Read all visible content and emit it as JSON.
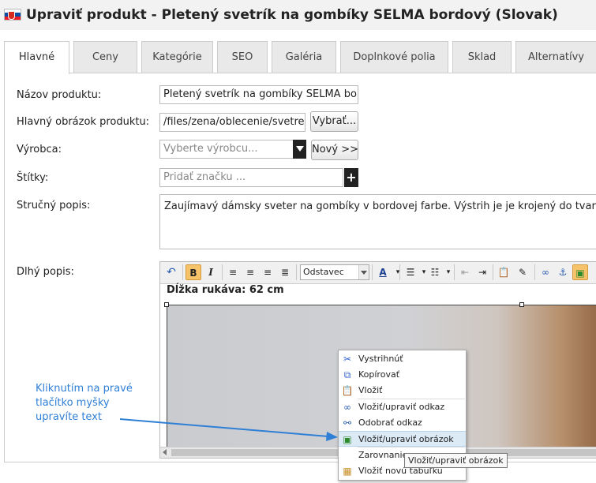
{
  "header": {
    "title": "Upraviť produkt - Pletený svetrík na gombíky SELMA bordový (Slovak)",
    "flag_colors": [
      "#ffffff",
      "#0b4ea2",
      "#ee1c25"
    ]
  },
  "tabs": [
    {
      "label": "Hlavné",
      "active": true
    },
    {
      "label": "Ceny"
    },
    {
      "label": "Kategórie"
    },
    {
      "label": "SEO"
    },
    {
      "label": "Galéria"
    },
    {
      "label": "Doplnkové polia"
    },
    {
      "label": "Sklad"
    },
    {
      "label": "Alternatívy"
    }
  ],
  "form": {
    "name_label": "Názov produktu:",
    "name_value": "Pletený svetrík na gombíky SELMA bordc",
    "image_label": "Hlavný obrázok produktu:",
    "image_value": "/files/zena/oblecenie/svetre-p",
    "image_button": "Vybrať...",
    "maker_label": "Výrobca:",
    "maker_placeholder": "Vyberte výrobcu...",
    "maker_new_button": "Nový >>",
    "tags_label": "Štítky:",
    "tags_placeholder": "Pridať značku ...",
    "short_label": "Stručný popis:",
    "short_value": "Zaujímavý dámsky sveter na gombíky v bordovej farbe. Výstrih je je krojený do tvaru V.",
    "long_label": "Dlhý popis:"
  },
  "editor": {
    "format_select": "Odstavec",
    "content_text": "Dĺžka rukáva: 62 cm"
  },
  "context_menu": {
    "items": [
      {
        "label": "Vystrihnúť",
        "icon": "scissors-icon"
      },
      {
        "label": "Kopírovať",
        "icon": "copy-icon"
      },
      {
        "label": "Vložiť",
        "icon": "paste-icon"
      },
      {
        "label": "Vložiť/upraviť odkaz",
        "icon": "link-icon"
      },
      {
        "label": "Odobrať odkaz",
        "icon": "unlink-icon"
      },
      {
        "label": "Vložiť/upraviť obrázok",
        "icon": "image-icon",
        "highlighted": true
      },
      {
        "label": "Zarovnanie",
        "icon": ""
      },
      {
        "label": "Vložiť novú tabuľku",
        "icon": "table-icon"
      }
    ]
  },
  "tooltip": "Vložiť/upraviť obrázok",
  "annotation": {
    "line1": "Kliknutím na pravé",
    "line2": "tlačítko myšky",
    "line3": "upravíte text",
    "color": "#2f7fd6"
  }
}
